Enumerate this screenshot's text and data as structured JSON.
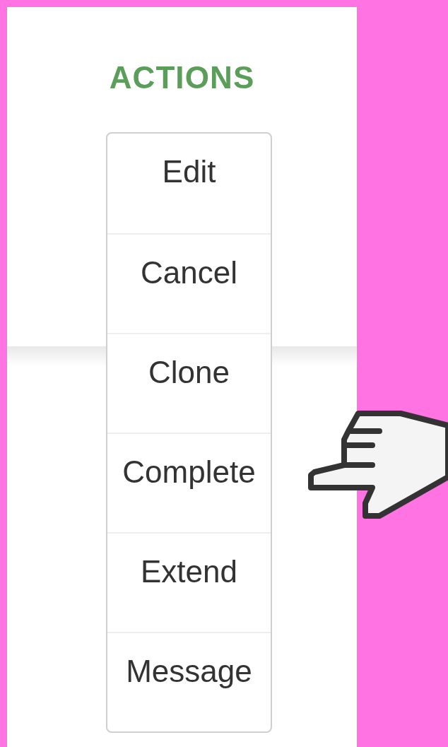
{
  "title": "ACTIONS",
  "menu": [
    {
      "label": "Edit"
    },
    {
      "label": "Cancel"
    },
    {
      "label": "Clone"
    },
    {
      "label": "Complete"
    },
    {
      "label": "Extend"
    },
    {
      "label": "Message"
    }
  ]
}
